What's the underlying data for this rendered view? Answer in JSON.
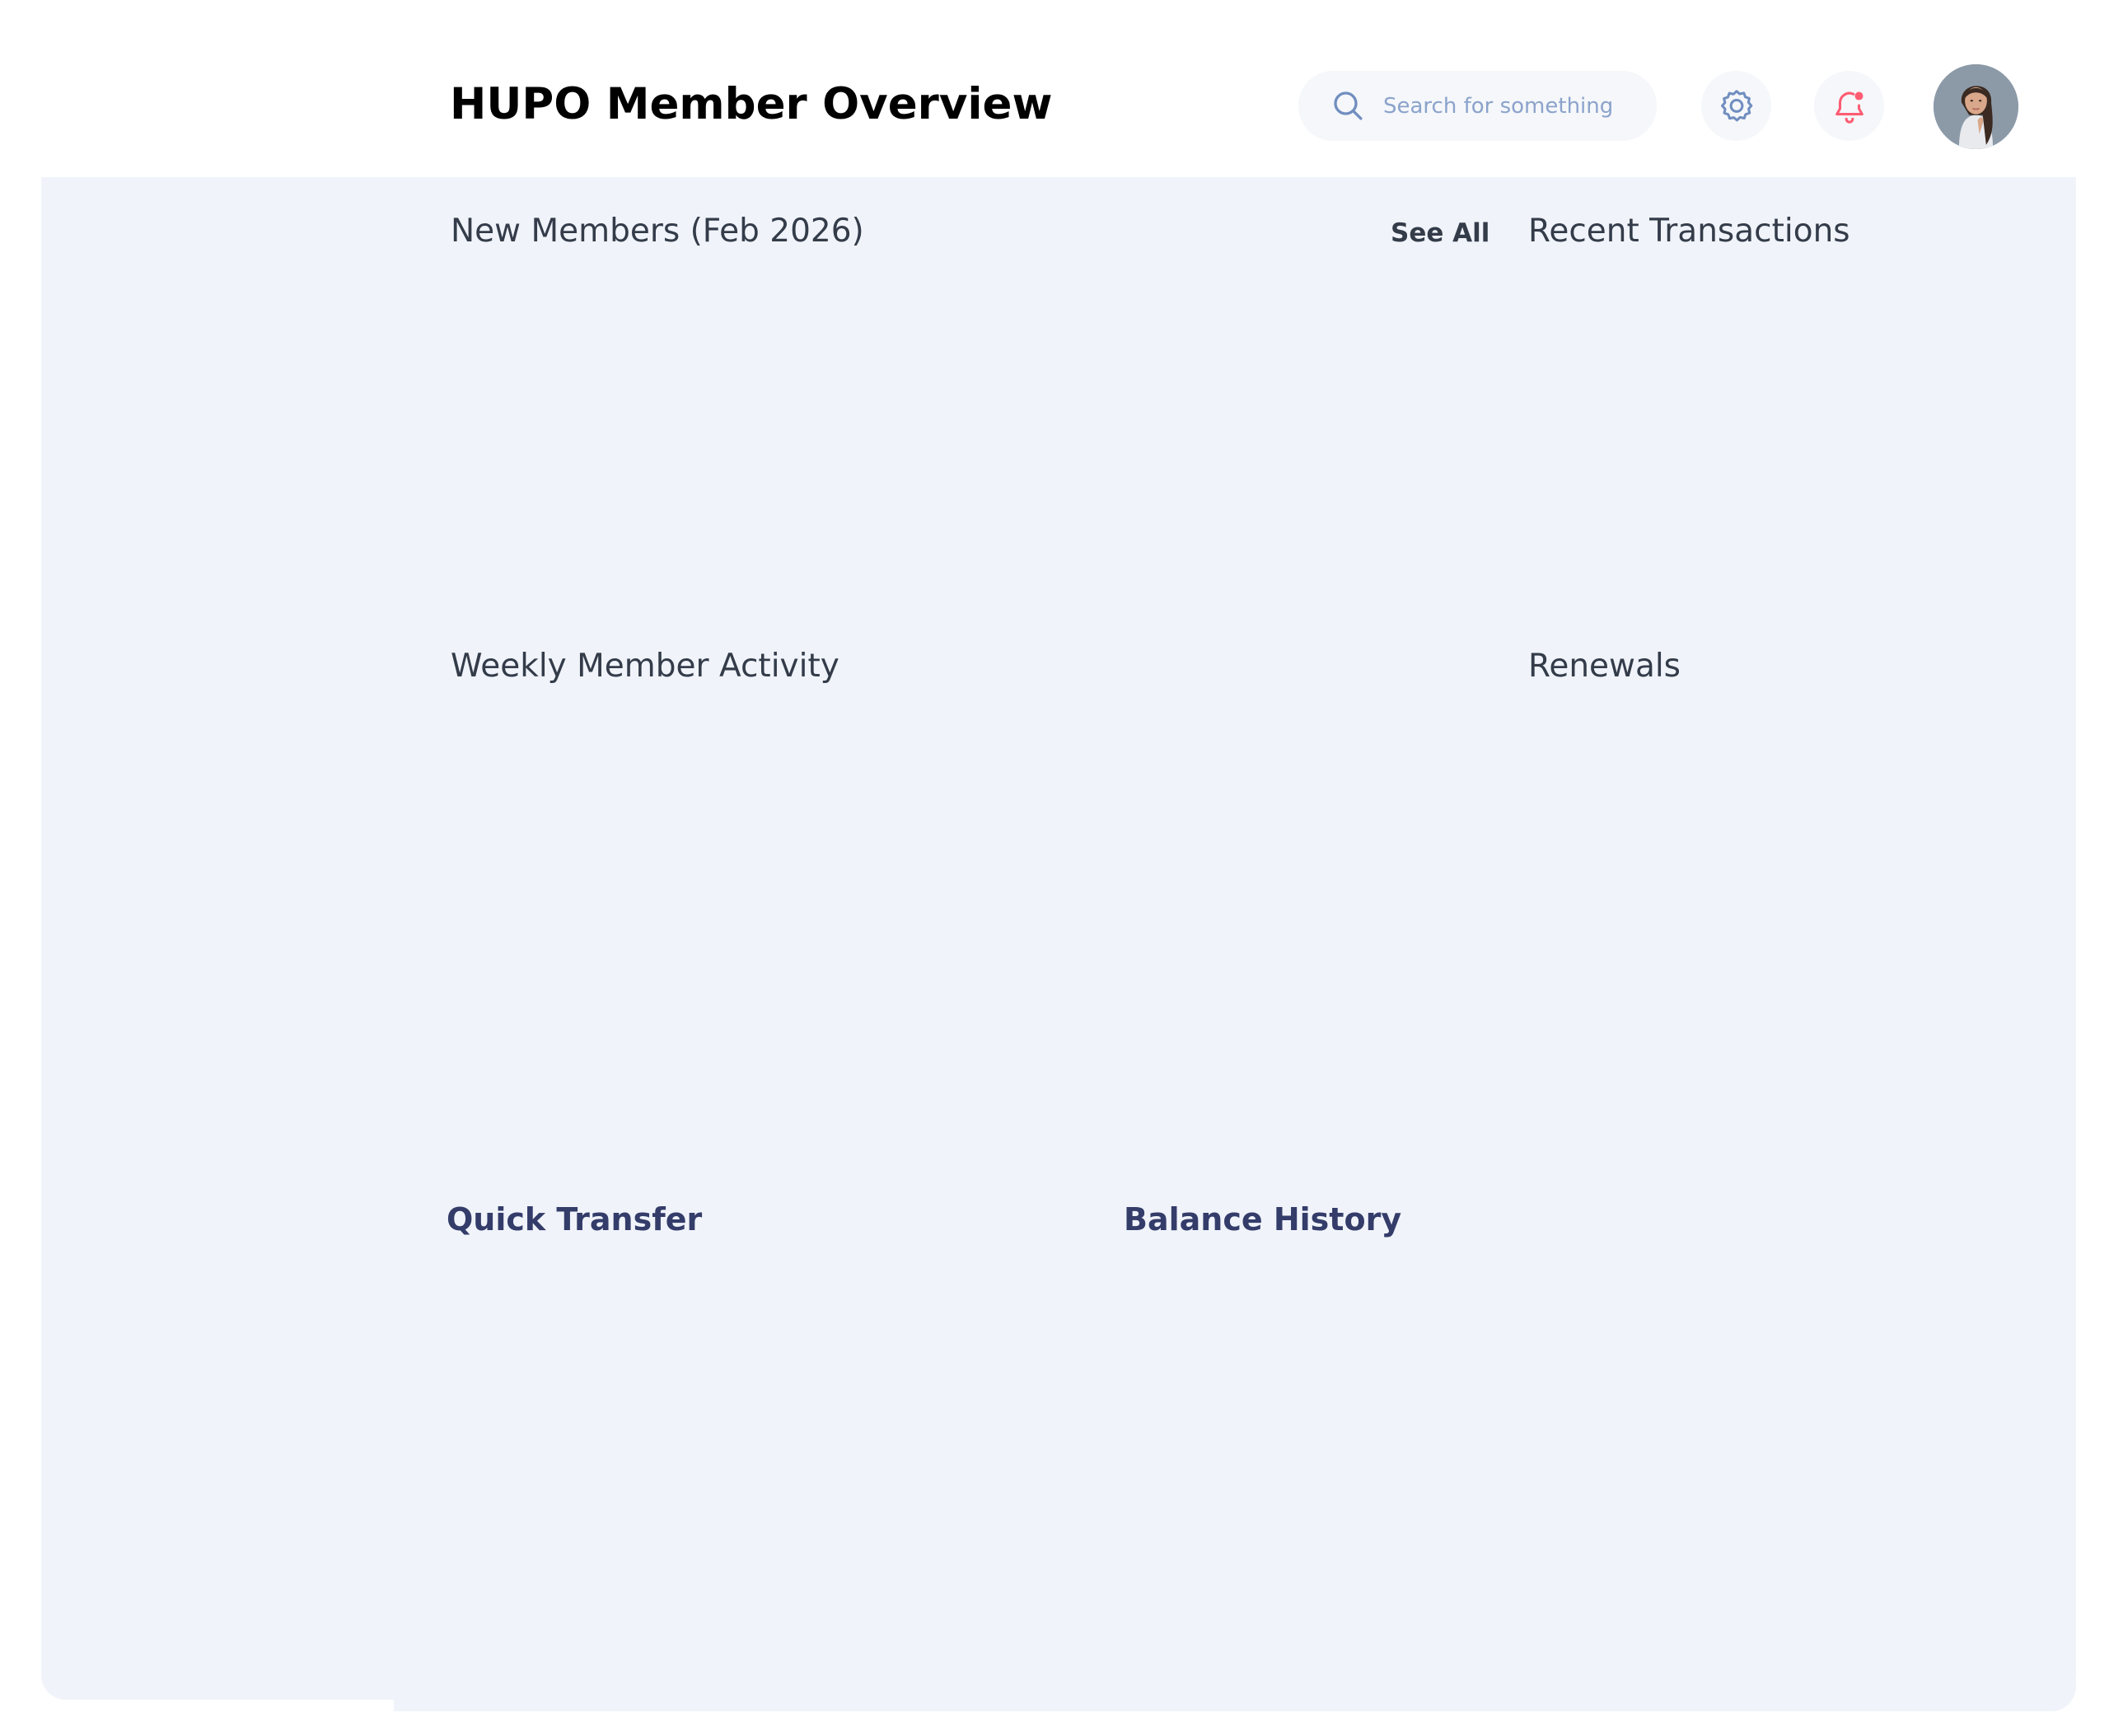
{
  "header": {
    "title": "HUPO Member Overview",
    "search": {
      "placeholder": "Search for something",
      "value": ""
    }
  },
  "sections": {
    "new_members": {
      "title": "New Members (Feb 2026)",
      "see_all": "See All"
    },
    "recent_transactions": {
      "title": "Recent Transactions"
    },
    "weekly_activity": {
      "title": "Weekly Member Activity"
    },
    "renewals": {
      "title": "Renewals"
    },
    "quick_transfer": {
      "title": "Quick Transfer"
    },
    "balance_history": {
      "title": "Balance History"
    }
  },
  "colors": {
    "content_bg": "#f0f4fa",
    "heading_dark": "#343c4a",
    "heading_blue": "#343c6a",
    "search_text": "#8ba3cb",
    "icon_gray": "#718ebf",
    "bell_red": "#fe5c73"
  },
  "icons": {
    "search": "search-icon",
    "settings": "gear-icon",
    "notifications": "bell-icon"
  }
}
